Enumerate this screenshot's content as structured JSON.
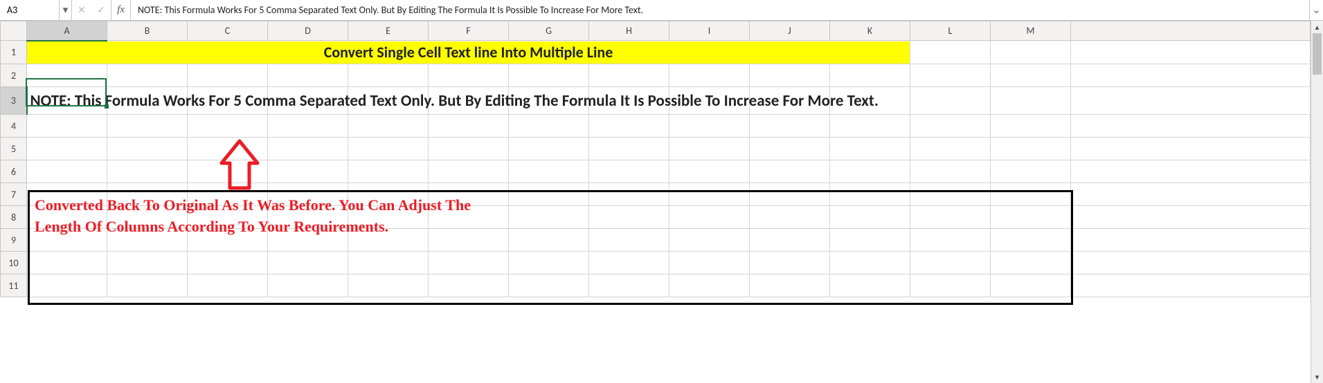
{
  "formula_bar": {
    "cell_ref": "A3",
    "formula": "NOTE: This Formula Works For 5 Comma Separated Text Only. But By Editing The Formula It Is Possible To Increase For More Text."
  },
  "icons": {
    "name_dropdown": "▾",
    "cancel": "✕",
    "enter": "✓",
    "fx": "fx",
    "expand": "⌄",
    "scroll_up": "▲",
    "scroll_down": "▼"
  },
  "columns": [
    "A",
    "B",
    "C",
    "D",
    "E",
    "F",
    "G",
    "H",
    "I",
    "J",
    "K",
    "L",
    "M"
  ],
  "rows": [
    "1",
    "2",
    "3",
    "4",
    "5",
    "6",
    "7",
    "8",
    "9",
    "10",
    "11"
  ],
  "content": {
    "title": "Convert Single Cell Text line Into Multiple Line",
    "note": "NOTE: This Formula Works For 5 Comma Separated Text Only. But By Editing The Formula It Is Possible To Increase For More Text.",
    "commentary_line1": "Converted Back To Original As It Was Before. You Can Adjust The",
    "commentary_line2": "Length Of Columns According To Your Requirements."
  },
  "colors": {
    "highlight": "#ffff00",
    "commentary": "#ed1c24",
    "selection": "#217346"
  }
}
